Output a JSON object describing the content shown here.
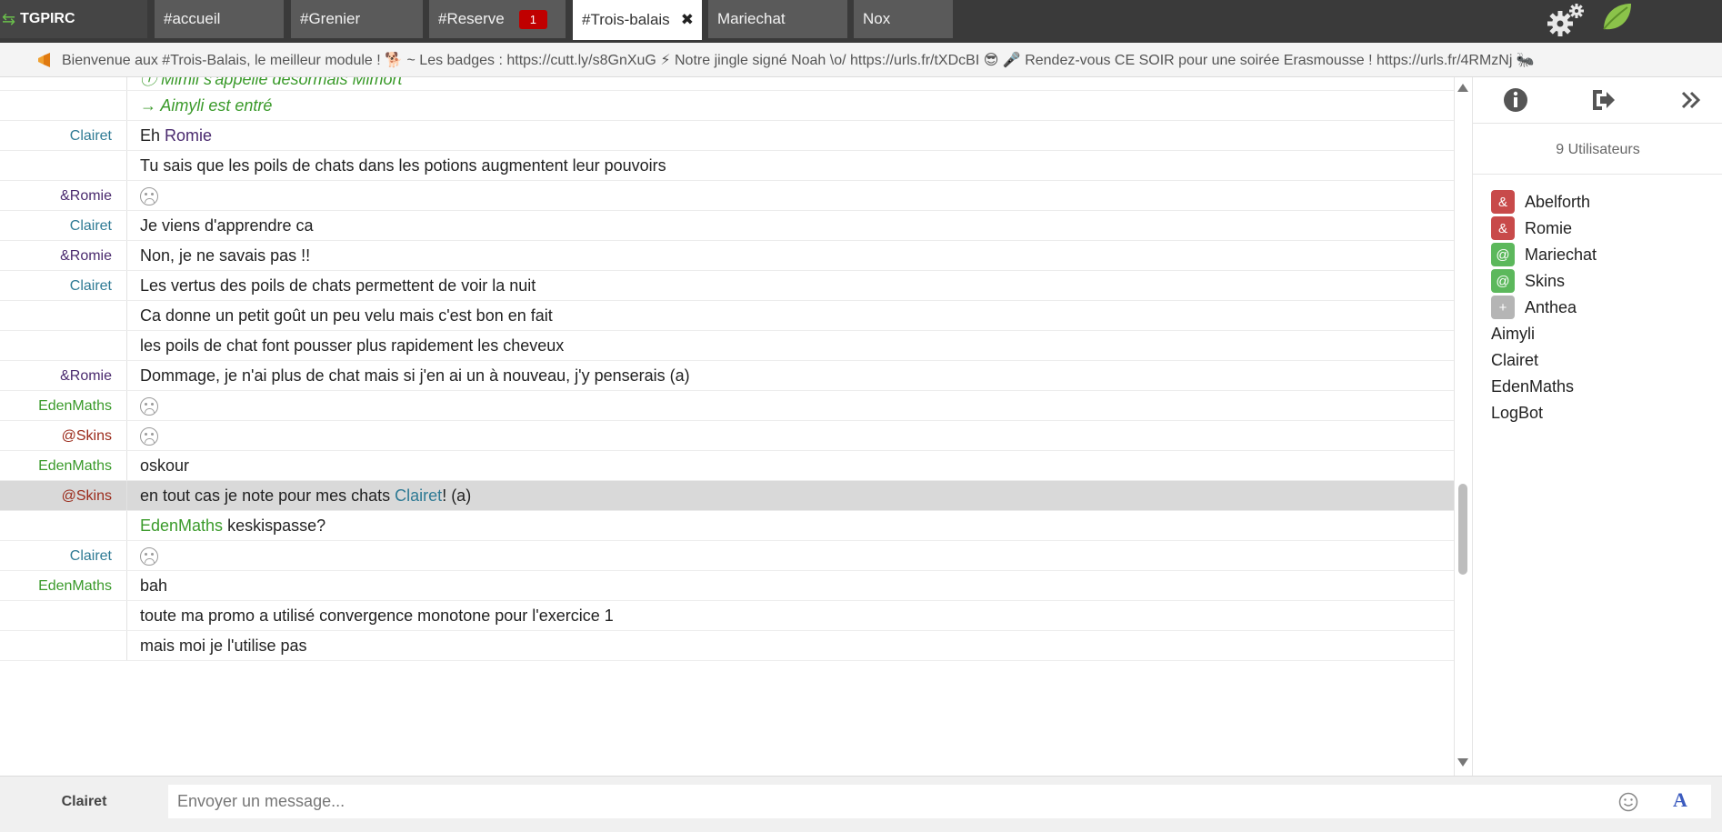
{
  "brand": {
    "name": "TGPIRC"
  },
  "tabs": [
    {
      "label": "#accueil"
    },
    {
      "label": "#Grenier"
    },
    {
      "label": "#Reserve",
      "badge": "1"
    },
    {
      "label": "#Trois-balais",
      "close": "✖"
    },
    {
      "label": "Mariechat"
    },
    {
      "label": "Nox"
    }
  ],
  "topic": {
    "text": "Bienvenue aux #Trois-Balais, le meilleur module ! 🐕 ~ Les badges : https://cutt.ly/s8GnXuG ⚡ Notre jingle signé Noah \\o/ https://urls.fr/tXDcBI 😎 🎤 Rendez-vous CE SOIR pour une soirée Erasmousse ! https://urls.fr/4RMzNj 🐜"
  },
  "messages": [
    {
      "nick": "",
      "text": "ⓘ Mimil s'appelle désormais Mimort",
      "type": "sys"
    },
    {
      "nick": "",
      "text": "→ Aimyli est entré",
      "type": "sys"
    },
    {
      "nick": "Clairet",
      "prefix": "Eh ",
      "mention": "Romie",
      "rest": ""
    },
    {
      "nick": "",
      "text": "Tu sais que les poils de chats dans les potions augmentent leur pouvoirs"
    },
    {
      "nick": "&Romie",
      "emoji": "dizzy"
    },
    {
      "nick": "Clairet",
      "text": "Je viens d'apprendre ca"
    },
    {
      "nick": "&Romie",
      "text": "Non, je ne savais pas !!"
    },
    {
      "nick": "Clairet",
      "text": "Les vertus des poils de chats permettent de voir la nuit"
    },
    {
      "nick": "",
      "text": "Ca donne un petit goût un peu velu mais c'est bon en fait"
    },
    {
      "nick": "",
      "text": "les poils de chat font pousser plus rapidement les cheveux"
    },
    {
      "nick": "&Romie",
      "text": "Dommage, je n'ai plus de chat mais si j'en ai un à nouveau, j'y penserais (a)"
    },
    {
      "nick": "EdenMaths",
      "emoji": "sad"
    },
    {
      "nick": "@Skins",
      "emoji": "sad"
    },
    {
      "nick": "EdenMaths",
      "text": "oskour"
    },
    {
      "nick": "@Skins",
      "prefix": "en tout cas je note pour mes chats ",
      "mention": "Clairet",
      "rest": "! (a)",
      "highlight": true
    },
    {
      "nick": "",
      "prefix": "",
      "mention": "EdenMaths",
      "rest": " keskispasse?"
    },
    {
      "nick": "Clairet",
      "emoji": "laugh"
    },
    {
      "nick": "EdenMaths",
      "text": "bah"
    },
    {
      "nick": "",
      "text": "toute ma promo a utilisé convergence monotone pour l'exercice 1"
    },
    {
      "nick": "",
      "text": "mais moi je l'utilise pas"
    }
  ],
  "sidebar": {
    "user_count": "9 Utilisateurs",
    "icons": [
      "info-icon",
      "leave-icon",
      "collapse-icon"
    ],
    "users": [
      {
        "mode": "&",
        "name": "Abelforth"
      },
      {
        "mode": "&",
        "name": "Romie"
      },
      {
        "mode": "@",
        "name": "Mariechat"
      },
      {
        "mode": "@",
        "name": "Skins"
      },
      {
        "mode": "+",
        "name": "Anthea"
      },
      {
        "mode": "",
        "name": "Aimyli"
      },
      {
        "mode": "",
        "name": "Clairet"
      },
      {
        "mode": "",
        "name": "EdenMaths"
      },
      {
        "mode": "",
        "name": "LogBot"
      }
    ]
  },
  "footer": {
    "own_nick": "Clairet",
    "placeholder": "Envoyer un message...",
    "font_button": "A"
  },
  "colors": {
    "topbar": "#3a3a3a",
    "tab": "#5a5a5a",
    "badge": "#c00000",
    "system": "#3a9a2a",
    "owner": "#c84a4a",
    "op": "#5cb85c",
    "voice": "#b5b5b5"
  }
}
